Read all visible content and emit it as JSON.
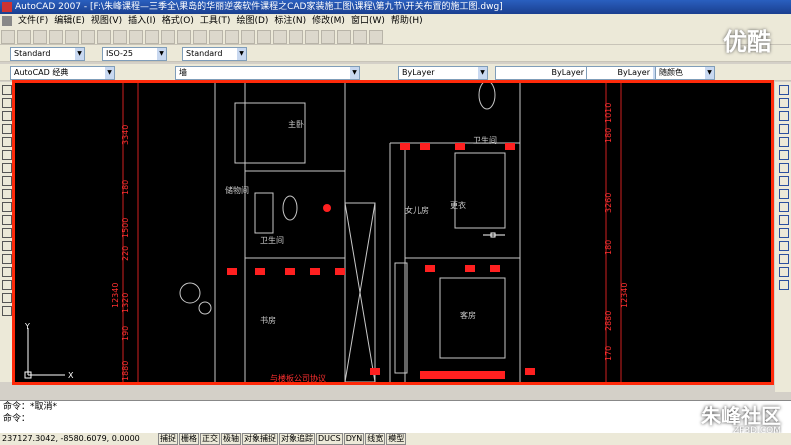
{
  "window": {
    "title": "AutoCAD 2007 - [F:\\朱峰课程—三季全\\果岛的华丽逆袭软件课程之CAD家装施工图\\课程\\第九节\\开关布置的施工图.dwg]"
  },
  "menu": {
    "items": [
      "文件(F)",
      "编辑(E)",
      "视图(V)",
      "插入(I)",
      "格式(O)",
      "工具(T)",
      "绘图(D)",
      "标注(N)",
      "修改(M)",
      "窗口(W)",
      "帮助(H)"
    ]
  },
  "styles": {
    "text_style": "Standard",
    "dim_style": "ISO-25",
    "table_style": "Standard"
  },
  "workspace": {
    "name": "AutoCAD 经典"
  },
  "layer": {
    "name": "墙"
  },
  "properties": {
    "color": "ByLayer",
    "linetype": "ByLayer",
    "lineweight": "ByLayer",
    "plotstyle": "随颜色"
  },
  "watermark": {
    "top": "优酷",
    "bottom": "朱峰社区",
    "url": "ZF3D.COM"
  },
  "drawing": {
    "rooms": [
      "主卧",
      "卫生间",
      "女儿房",
      "储物间",
      "更衣",
      "卫生间",
      "书房",
      "客房"
    ],
    "left_dims": [
      "3340",
      "180",
      "1500",
      "220",
      "1320",
      "190",
      "1880"
    ],
    "left_total": "12340",
    "right_dims": [
      "1010",
      "180",
      "3260",
      "180",
      "2880",
      "170"
    ],
    "right_total": "12340",
    "bottom_note": "与楼板公司协议",
    "ucs_x": "X",
    "ucs_y": "Y"
  },
  "command": {
    "line1": "命令：*取消*",
    "line2": "命令："
  },
  "status": {
    "coords": "237127.3042, -8580.6079, 0.0000",
    "toggles": [
      "捕捉",
      "栅格",
      "正交",
      "极轴",
      "对象捕捉",
      "对象追踪",
      "DUCS",
      "DYN",
      "线宽",
      "模型"
    ]
  },
  "colors": {
    "highlight": "#ff2a0a",
    "canvas": "#000000",
    "titlebar": "#1a3f8f"
  }
}
